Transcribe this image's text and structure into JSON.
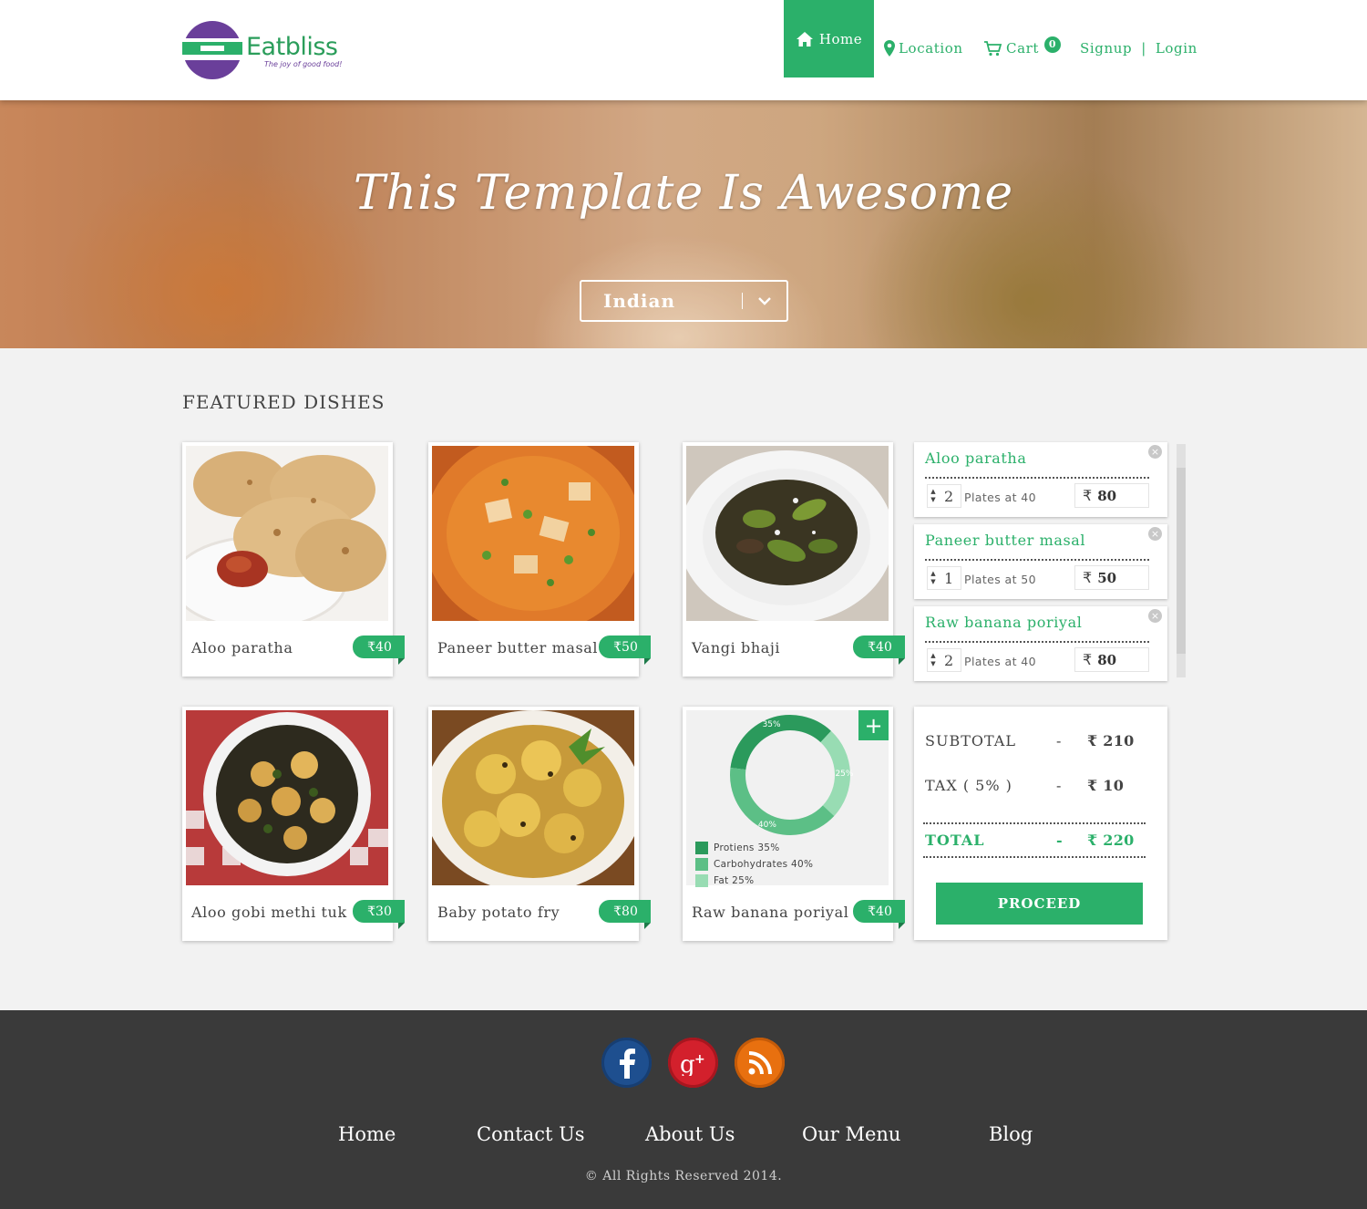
{
  "brand": {
    "name": "Eatbliss",
    "tagline": "The joy of good food!",
    "colors": {
      "green": "#2bb06a",
      "purple": "#6a3f9a",
      "footer": "#3a3a3a"
    }
  },
  "nav": {
    "home": "Home",
    "location": "Location",
    "cart": "Cart",
    "cart_count": "0",
    "signup": "Signup",
    "separator": "|",
    "login": "Login"
  },
  "hero": {
    "title": "This Template Is Awesome",
    "cuisine": "Indian"
  },
  "featured": {
    "title": "FEATURED DISHES",
    "dishes": [
      {
        "name": "Aloo paratha",
        "price": "₹40"
      },
      {
        "name": "Paneer butter masal",
        "price": "₹50"
      },
      {
        "name": "Vangi bhaji",
        "price": "₹40"
      },
      {
        "name": "Aloo gobi methi tuk",
        "price": "₹30"
      },
      {
        "name": "Baby potato fry",
        "price": "₹80"
      },
      {
        "name": "Raw banana poriyal",
        "price": "₹40"
      }
    ]
  },
  "nutrition": {
    "segments": [
      {
        "label": "Protiens 35%",
        "value": 35,
        "pct": "35%",
        "color": "#2b9a5c"
      },
      {
        "label": "Carbohydrates 40%",
        "value": 40,
        "pct": "40%",
        "color": "#5cbf86"
      },
      {
        "label": "Fat 25%",
        "value": 25,
        "pct": "25%",
        "color": "#98dcb3"
      }
    ]
  },
  "cart": {
    "currency": "₹",
    "items": [
      {
        "name": "Aloo paratha",
        "qty": "2",
        "plates": "Plates at 40",
        "total": "80"
      },
      {
        "name": "Paneer butter masal",
        "qty": "1",
        "plates": "Plates at 50",
        "total": "50"
      },
      {
        "name": "Raw banana poriyal",
        "qty": "2",
        "plates": "Plates at 40",
        "total": "80"
      }
    ],
    "close_glyph": "×",
    "up_glyph": "▲",
    "down_glyph": "▼"
  },
  "summary": {
    "subtotal_label": "SUBTOTAL",
    "subtotal": "₹ 210",
    "tax_label": "TAX ( 5% )",
    "tax": "₹ 10",
    "total_label": "TOTAL",
    "total": "₹ 220",
    "dash": "-",
    "proceed": "PROCEED"
  },
  "footer": {
    "links": [
      "Home",
      "Contact Us",
      "About Us",
      "Our Menu",
      "Blog"
    ],
    "copyright": "© All Rights Reserved 2014."
  }
}
